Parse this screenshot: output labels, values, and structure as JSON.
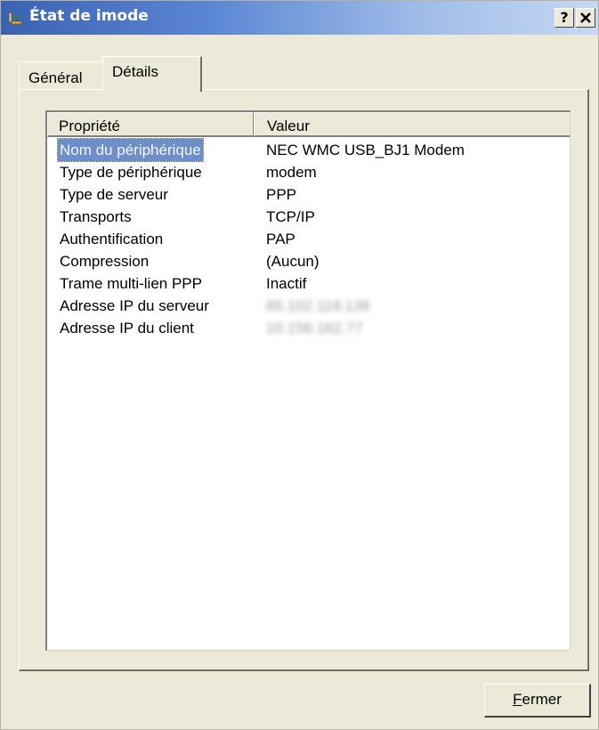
{
  "window": {
    "title": "État de imode",
    "help_label": "?",
    "close_label": "✕"
  },
  "tabs": [
    {
      "label": "Général",
      "selected": false
    },
    {
      "label": "Détails",
      "selected": true
    }
  ],
  "table": {
    "columns": [
      "Propriété",
      "Valeur"
    ],
    "rows": [
      {
        "property": "Nom du périphérique",
        "value": "NEC WMC USB_BJ1 Modem",
        "selected": true
      },
      {
        "property": "Type de périphérique",
        "value": "modem"
      },
      {
        "property": "Type de serveur",
        "value": "PPP"
      },
      {
        "property": "Transports",
        "value": "TCP/IP"
      },
      {
        "property": "Authentification",
        "value": "PAP"
      },
      {
        "property": "Compression",
        "value": "(Aucun)"
      },
      {
        "property": "Trame multi-lien PPP",
        "value": "Inactif"
      },
      {
        "property": "Adresse IP du serveur",
        "value": "85.102.119.136",
        "blurred": true
      },
      {
        "property": "Adresse IP du client",
        "value": "10.156.162.77",
        "blurred": true
      }
    ]
  },
  "footer": {
    "close_button": {
      "mnemonic": "F",
      "rest": "ermer"
    }
  },
  "colors": {
    "titlebar_start": "#3a62b3",
    "dialog_bg": "#ece9d8",
    "selection": "#6e8ec8"
  }
}
